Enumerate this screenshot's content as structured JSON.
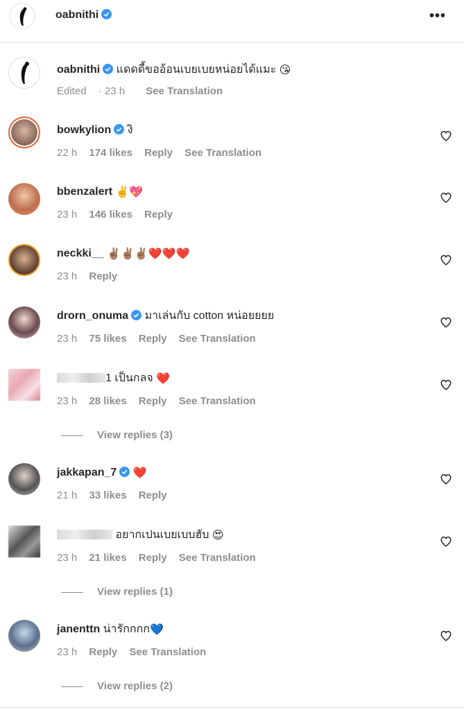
{
  "post": {
    "username": "oabnithi"
  },
  "caption": {
    "username": "oabnithi",
    "text": "แดดดี้ขออ้อนเบยเบยหน่อยได้แมะ",
    "emoji": "😘",
    "edited": "Edited",
    "time": "23 h",
    "see_translation": "See Translation"
  },
  "comments": [
    {
      "username": "bowkylion",
      "verified": true,
      "text": "งิ",
      "emoji": "",
      "time": "22 h",
      "likes": "174 likes",
      "reply": "Reply",
      "see_translation": "See Translation"
    },
    {
      "username": "bbenzalert",
      "verified": false,
      "text": "",
      "emoji": "✌️💖",
      "time": "23 h",
      "likes": "146 likes",
      "reply": "Reply",
      "see_translation": ""
    },
    {
      "username": "neckki__",
      "verified": false,
      "text": "",
      "emoji": "✌🏽✌🏽✌🏽❤️❤️❤️",
      "time": "23 h",
      "likes": "",
      "reply": "Reply",
      "see_translation": ""
    },
    {
      "username": "drorn_onuma",
      "verified": true,
      "text": "มาเล่นกับ cotton หน่อยยยย",
      "emoji": "",
      "time": "23 h",
      "likes": "75 likes",
      "reply": "Reply",
      "see_translation": "See Translation"
    },
    {
      "username": "",
      "verified": false,
      "text": "1 เป็นกลจ",
      "emoji": "❤️",
      "time": "23 h",
      "likes": "28 likes",
      "reply": "Reply",
      "see_translation": "See Translation",
      "view_replies": "View replies (3)"
    },
    {
      "username": "jakkapan_7",
      "verified": true,
      "text": "",
      "emoji": "❤️",
      "time": "21 h",
      "likes": "33 likes",
      "reply": "Reply",
      "see_translation": ""
    },
    {
      "username": "",
      "verified": false,
      "text": "อยากเปนเบยเบบฮับ",
      "emoji": "😍",
      "time": "23 h",
      "likes": "21 likes",
      "reply": "Reply",
      "see_translation": "See Translation",
      "view_replies": "View replies (1)"
    },
    {
      "username": "janenttn",
      "verified": false,
      "text": "น่ารักกกก",
      "emoji": "💙",
      "time": "23 h",
      "likes": "",
      "reply": "Reply",
      "see_translation": "See Translation",
      "view_replies": "View replies (2)"
    }
  ]
}
